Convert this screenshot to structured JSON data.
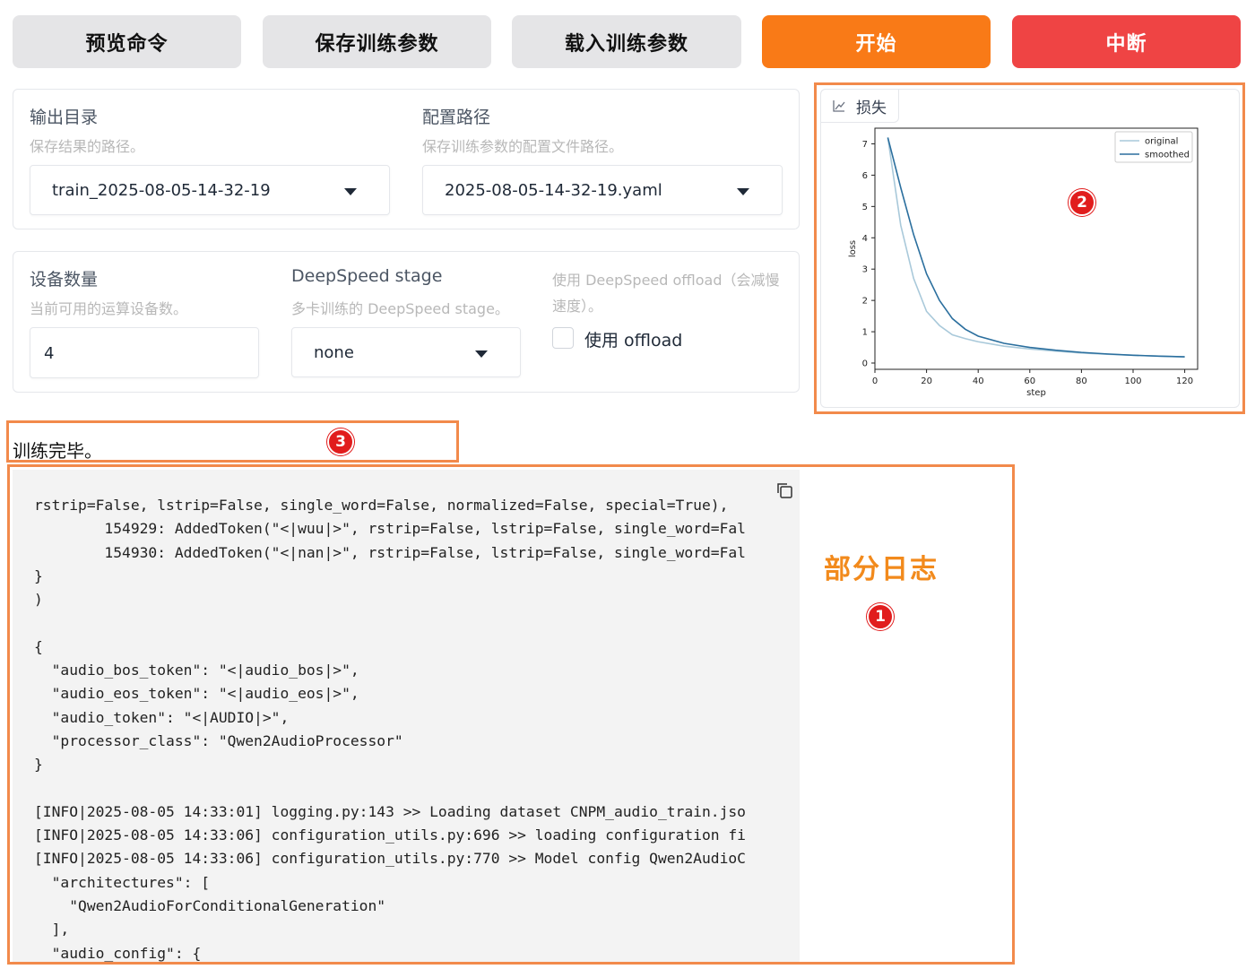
{
  "toolbar": {
    "preview_label": "预览命令",
    "save_label": "保存训练参数",
    "load_label": "载入训练参数",
    "start_label": "开始",
    "abort_label": "中断"
  },
  "output": {
    "output_dir_label": "输出目录",
    "output_dir_info": "保存结果的路径。",
    "output_dir_value": "train_2025-08-05-14-32-19",
    "config_path_label": "配置路径",
    "config_path_info": "保存训练参数的配置文件路径。",
    "config_path_value": "2025-08-05-14-32-19.yaml"
  },
  "device": {
    "device_count_label": "设备数量",
    "device_count_info": "当前可用的运算设备数。",
    "device_count_value": "4",
    "ds_stage_label": "DeepSpeed stage",
    "ds_stage_info": "多卡训练的 DeepSpeed stage。",
    "ds_stage_value": "none",
    "ds_offload_info_line1": "使用 DeepSpeed offload（会减慢",
    "ds_offload_info_line2": "速度）。",
    "ds_offload_label": "使用 offload",
    "ds_offload_checked": false
  },
  "plot_tab_label": "损失",
  "status_text": "训练完毕。",
  "annotations": {
    "badge1": "1",
    "badge2": "2",
    "badge3": "3",
    "partial_log_label": "部分日志"
  },
  "log_lines": [
    "rstrip=False, lstrip=False, single_word=False, normalized=False, special=True),",
    "        154929: AddedToken(\"<|wuu|>\", rstrip=False, lstrip=False, single_word=Fal",
    "        154930: AddedToken(\"<|nan|>\", rstrip=False, lstrip=False, single_word=Fal",
    "}",
    ")",
    "",
    "{",
    "  \"audio_bos_token\": \"<|audio_bos|>\",",
    "  \"audio_eos_token\": \"<|audio_eos|>\",",
    "  \"audio_token\": \"<|AUDIO|>\",",
    "  \"processor_class\": \"Qwen2AudioProcessor\"",
    "}",
    "",
    "[INFO|2025-08-05 14:33:01] logging.py:143 >> Loading dataset CNPM_audio_train.jso",
    "[INFO|2025-08-05 14:33:06] configuration_utils.py:696 >> loading configuration fi",
    "[INFO|2025-08-05 14:33:06] configuration_utils.py:770 >> Model config Qwen2AudioC",
    "  \"architectures\": [",
    "    \"Qwen2AudioForConditionalGeneration\"",
    "  ],",
    "  \"audio_config\": {"
  ],
  "chart_data": {
    "type": "line",
    "title": "",
    "xlabel": "step",
    "ylabel": "loss",
    "xlim": [
      0,
      125
    ],
    "ylim": [
      -0.2,
      7.5
    ],
    "xticks": [
      0,
      20,
      40,
      60,
      80,
      100,
      120
    ],
    "yticks": [
      0,
      1,
      2,
      3,
      4,
      5,
      6,
      7
    ],
    "legend": "top-right",
    "grid": false,
    "series": [
      {
        "name": "original",
        "color": "#a9c9da",
        "x": [
          5,
          10,
          15,
          20,
          25,
          30,
          35,
          40,
          50,
          60,
          70,
          80,
          90,
          100,
          110,
          120
        ],
        "y": [
          7.2,
          4.4,
          2.7,
          1.65,
          1.2,
          0.9,
          0.78,
          0.68,
          0.54,
          0.45,
          0.38,
          0.32,
          0.28,
          0.25,
          0.22,
          0.2
        ]
      },
      {
        "name": "smoothed",
        "color": "#2b6f9e",
        "x": [
          5,
          10,
          15,
          20,
          25,
          30,
          35,
          40,
          50,
          60,
          70,
          80,
          90,
          100,
          110,
          120
        ],
        "y": [
          7.2,
          5.6,
          4.1,
          2.85,
          2.0,
          1.42,
          1.08,
          0.86,
          0.63,
          0.5,
          0.41,
          0.34,
          0.29,
          0.25,
          0.22,
          0.2
        ]
      }
    ]
  }
}
